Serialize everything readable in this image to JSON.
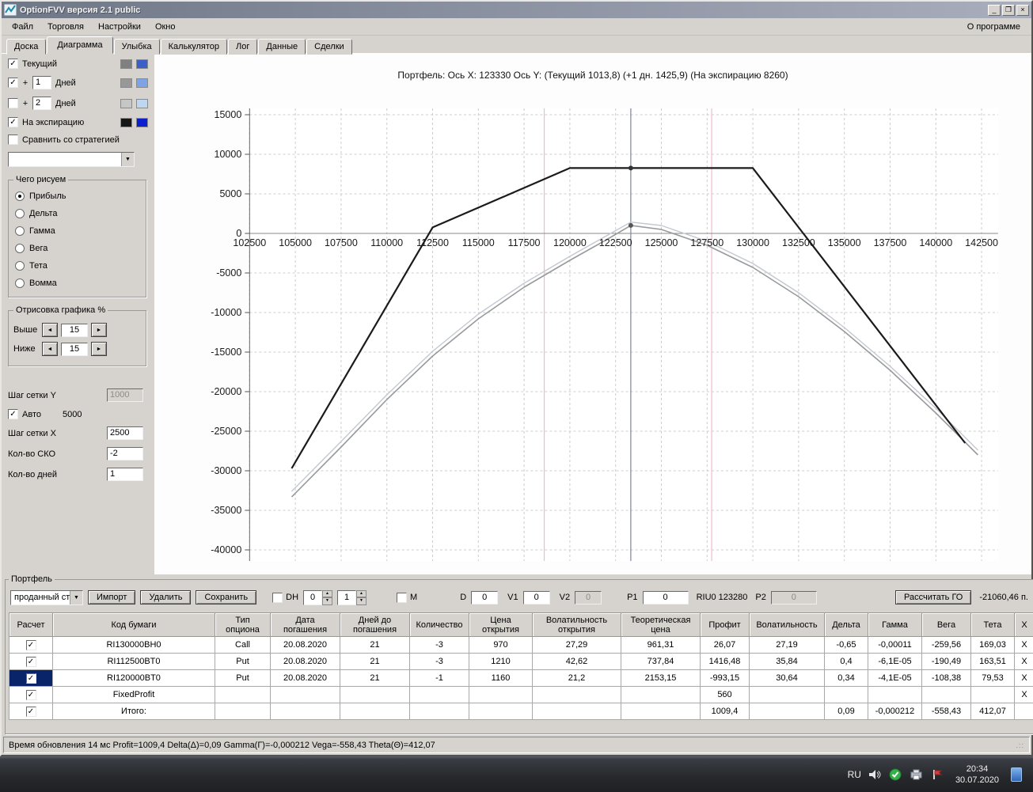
{
  "window": {
    "title": "OptionFVV версия 2.1 public",
    "minimize": "_",
    "maximize": "❐",
    "close": "×"
  },
  "menu": {
    "items": [
      "Файл",
      "Торговля",
      "Настройки",
      "Окно"
    ],
    "right": "О программе"
  },
  "tabs": {
    "items": [
      "Доска",
      "Диаграмма",
      "Улыбка",
      "Калькулятор",
      "Лог",
      "Данные",
      "Сделки"
    ],
    "active": "Диаграмма"
  },
  "sidebar": {
    "series_rows": [
      {
        "checked": true,
        "label": "Текущий",
        "swatches": [
          "#808080",
          "#3a5fc8"
        ]
      },
      {
        "checked": true,
        "prefix": "+",
        "value": "1",
        "label": "Дней",
        "swatches": [
          "#989898",
          "#7da3e6"
        ]
      },
      {
        "checked": false,
        "prefix": "+",
        "value": "2",
        "label": "Дней",
        "swatches": [
          "#c6c6c6",
          "#bdd7f2"
        ]
      },
      {
        "checked": true,
        "label": "На экспирацию",
        "swatches": [
          "#161616",
          "#0b1fd0"
        ]
      },
      {
        "checked": false,
        "label": "Сравнить со стратегией"
      }
    ],
    "strategy_dropdown_value": "",
    "draw_group": {
      "title": "Чего рисуем",
      "options": [
        "Прибыль",
        "Дельта",
        "Гамма",
        "Вега",
        "Тета",
        "Вомма"
      ],
      "selected": "Прибыль"
    },
    "range_group": {
      "title": "Отрисовка графика %",
      "rows": [
        {
          "label": "Выше",
          "value": "15"
        },
        {
          "label": "Ниже",
          "value": "15"
        }
      ]
    },
    "grid_y": {
      "label": "Шаг сетки Y",
      "value": "1000",
      "auto_label": "Авто",
      "auto_checked": true,
      "auto_value": "5000"
    },
    "grid_x": {
      "label": "Шаг сетки X",
      "value": "2500"
    },
    "sko": {
      "label": "Кол-во СКО",
      "value": "-2"
    },
    "days": {
      "label": "Кол-во дней",
      "value": "1"
    }
  },
  "chart_data": {
    "type": "line",
    "title": "Портфель:  Ось X: 123330  Ось Y:  (Текущий 1013,8)  (+1 дн. 1425,9)  (На экспирацию 8260)",
    "xlabel": "",
    "ylabel": "",
    "grid": "dashed",
    "xlim": [
      102500,
      143400
    ],
    "ylim": [
      -41400,
      15800
    ],
    "x_ticks": [
      102500,
      105000,
      107500,
      110000,
      112500,
      115000,
      117500,
      120000,
      122500,
      125000,
      127500,
      130000,
      132500,
      135000,
      137500,
      140000,
      142500
    ],
    "y_ticks": [
      15000,
      10000,
      5000,
      0,
      -5000,
      -10000,
      -15000,
      -20000,
      -25000,
      -30000,
      -35000,
      -40000
    ],
    "series": [
      {
        "name": "+1 день",
        "color": "#c2c8d2",
        "width": 1.4,
        "points": [
          [
            104800,
            -32600
          ],
          [
            107500,
            -26300
          ],
          [
            110000,
            -20400
          ],
          [
            112500,
            -14900
          ],
          [
            115000,
            -10200
          ],
          [
            117500,
            -6300
          ],
          [
            120000,
            -2900
          ],
          [
            122000,
            -300
          ],
          [
            123330,
            1426
          ],
          [
            125000,
            1000
          ],
          [
            127500,
            -1000
          ],
          [
            130000,
            -3800
          ],
          [
            132500,
            -7500
          ],
          [
            135000,
            -11900
          ],
          [
            137500,
            -16800
          ],
          [
            140000,
            -22100
          ],
          [
            142300,
            -27400
          ]
        ]
      },
      {
        "name": "Текущий",
        "color": "#9a9a9a",
        "width": 1.6,
        "points": [
          [
            104800,
            -33300
          ],
          [
            107500,
            -27000
          ],
          [
            110000,
            -21000
          ],
          [
            112500,
            -15500
          ],
          [
            115000,
            -10800
          ],
          [
            117500,
            -6800
          ],
          [
            120000,
            -3400
          ],
          [
            122000,
            -800
          ],
          [
            123330,
            1013
          ],
          [
            125000,
            500
          ],
          [
            127500,
            -1500
          ],
          [
            130000,
            -4300
          ],
          [
            132500,
            -8000
          ],
          [
            135000,
            -12400
          ],
          [
            137500,
            -17300
          ],
          [
            140000,
            -22700
          ],
          [
            142300,
            -28000
          ]
        ]
      },
      {
        "name": "На экспирацию",
        "color": "#1b1b1b",
        "width": 2.2,
        "points": [
          [
            104800,
            -29700
          ],
          [
            112500,
            760
          ],
          [
            120000,
            8260
          ],
          [
            130000,
            8260
          ],
          [
            141600,
            -26500
          ]
        ]
      }
    ],
    "vlines": [
      {
        "x": 118600,
        "color": "#f2b9ca",
        "name": "sko-left"
      },
      {
        "x": 127750,
        "color": "#f2b9ca",
        "name": "sko-right"
      },
      {
        "x": 123330,
        "color": "#7d8698",
        "name": "current-price"
      }
    ],
    "markers": [
      {
        "x": 123330,
        "y": 8260,
        "color": "#333333"
      },
      {
        "x": 123330,
        "y": 1013,
        "color": "#555555"
      }
    ]
  },
  "portfolio": {
    "group_title": "Портфель",
    "toolbar": {
      "strategy_select": "проданный ст",
      "import": "Импорт",
      "delete": "Удалить",
      "save": "Сохранить",
      "dh_label": "DH",
      "dh_spin1": "0",
      "dh_spin2": "1",
      "m_label": "М",
      "d_label": "D",
      "d_value": "0",
      "v1_label": "V1",
      "v1_value": "0",
      "v2_label": "V2",
      "v2_value": "0",
      "p1_label": "P1",
      "p1_value": "0",
      "ticker": "RIU0 123280",
      "p2_label": "P2",
      "p2_value": "0",
      "calc_button": "Рассчитать ГО",
      "margin_value": "-21060,46 п."
    },
    "table": {
      "columns": [
        "Расчет",
        "Код бумаги",
        "Тип\nопциона",
        "Дата\nпогашения",
        "Дней до\nпогашения",
        "Количество",
        "Цена\nоткрытия",
        "Волатильность\nоткрытия",
        "Теоретическая\nцена",
        "Профит",
        "Волатильность",
        "Дельта",
        "Гамма",
        "Вега",
        "Тета",
        "X"
      ],
      "rows": [
        {
          "checked": true,
          "selected": false,
          "profit_bg": "green",
          "close": "X",
          "values": [
            "RI130000BH0",
            "Call",
            "20.08.2020",
            "21",
            "-3",
            "970",
            "27,29",
            "961,31",
            "26,07",
            "27,19",
            "-0,65",
            "-0,00011",
            "-259,56",
            "169,03"
          ]
        },
        {
          "checked": true,
          "selected": false,
          "profit_bg": "green",
          "close": "X",
          "values": [
            "RI112500BT0",
            "Put",
            "20.08.2020",
            "21",
            "-3",
            "1210",
            "42,62",
            "737,84",
            "1416,48",
            "35,84",
            "0,4",
            "-6,1E-05",
            "-190,49",
            "163,51"
          ]
        },
        {
          "checked": true,
          "selected": true,
          "profit_bg": "red",
          "close": "X",
          "values": [
            "RI120000BT0",
            "Put",
            "20.08.2020",
            "21",
            "-1",
            "1160",
            "21,2",
            "2153,15",
            "-993,15",
            "30,64",
            "0,34",
            "-4,1E-05",
            "-108,38",
            "79,53"
          ]
        },
        {
          "checked": true,
          "selected": false,
          "profit_bg": "green",
          "close": "X",
          "values": [
            "FixedProfit",
            "",
            "",
            "",
            "",
            "",
            "",
            "",
            "560",
            "",
            "",
            "",
            "",
            ""
          ]
        },
        {
          "checked": true,
          "selected": false,
          "profit_bg": "green",
          "close": "",
          "values": [
            "Итого:",
            "",
            "",
            "",
            "",
            "",
            "",
            "",
            "1009,4",
            "",
            "0,09",
            "-0,000212",
            "-558,43",
            "412,07"
          ]
        }
      ]
    }
  },
  "statusbar": {
    "text": "Время обновления 14 мс  Profit=1009,4 Delta(Δ)=0,09 Gamma(Г)=-0,000212 Vega=-558,43 Theta(Θ)=412,07"
  },
  "taskbar": {
    "lang": "RU",
    "time": "20:34",
    "date": "30.07.2020"
  }
}
